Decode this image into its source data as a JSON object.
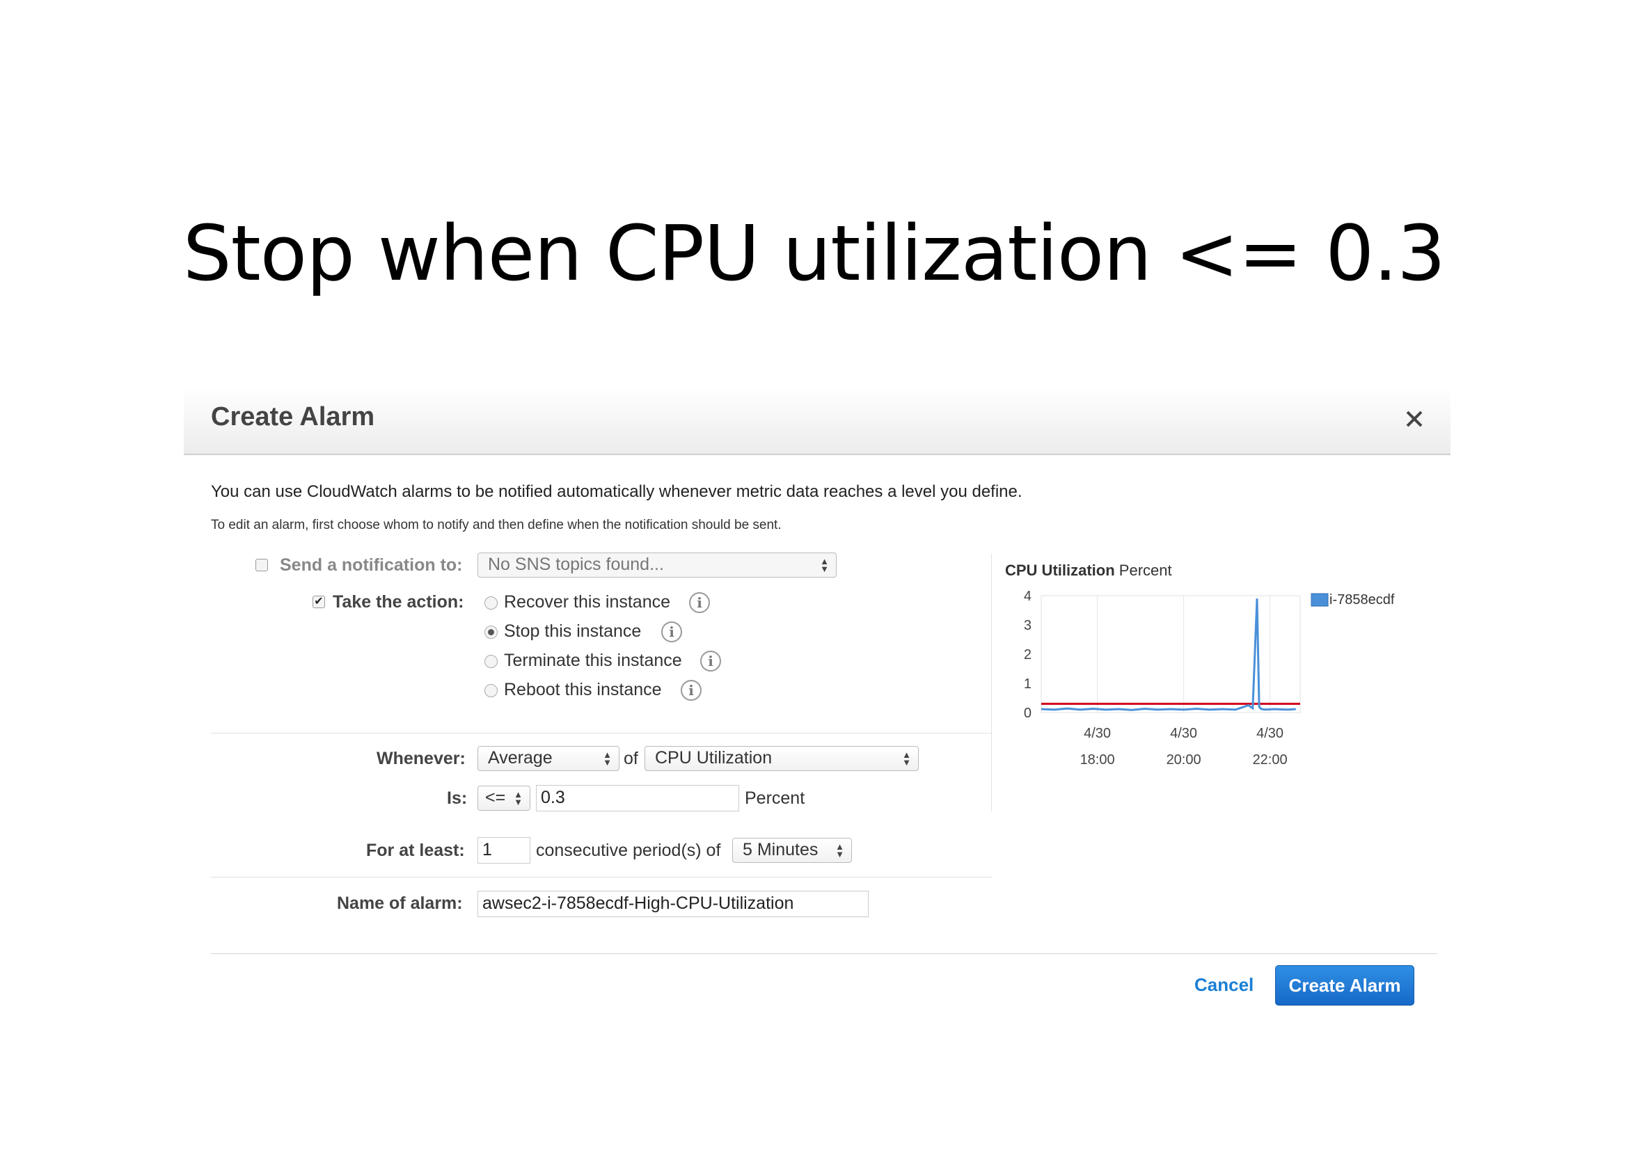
{
  "slide": {
    "title": "Stop when CPU utilization <= 0.3"
  },
  "dialog": {
    "title": "Create Alarm",
    "intro": "You can use CloudWatch alarms to be notified automatically whenever metric data reaches a level you define.",
    "intro_small": "To edit an alarm, first choose whom to notify and then define when the notification should be sent.",
    "notification": {
      "label": "Send a notification to:",
      "checked": false,
      "select_value": "No SNS topics found..."
    },
    "action": {
      "label": "Take the action:",
      "checked": true,
      "options": [
        {
          "label": "Recover this instance",
          "selected": false
        },
        {
          "label": "Stop this instance",
          "selected": true
        },
        {
          "label": "Terminate this instance",
          "selected": false
        },
        {
          "label": "Reboot this instance",
          "selected": false
        }
      ]
    },
    "whenever": {
      "label": "Whenever:",
      "statistic": "Average",
      "of_text": "of",
      "metric": "CPU Utilization"
    },
    "is": {
      "label": "Is:",
      "operator": "<=",
      "value": "0.3",
      "unit": "Percent"
    },
    "for_at_least": {
      "label": "For at least:",
      "periods": "1",
      "text": "consecutive period(s) of",
      "period": "5 Minutes"
    },
    "name": {
      "label": "Name of alarm:",
      "value": "awsec2-i-7858ecdf-High-CPU-Utilization"
    },
    "buttons": {
      "cancel": "Cancel",
      "create": "Create Alarm"
    }
  },
  "chart_data": {
    "type": "line",
    "title": "CPU Utilization",
    "unit_label": "Percent",
    "ylim": [
      0,
      4
    ],
    "y_ticks": [
      "4",
      "3",
      "2",
      "1",
      "0"
    ],
    "x_ticks": [
      {
        "date": "4/30",
        "time": "18:00"
      },
      {
        "date": "4/30",
        "time": "20:00"
      },
      {
        "date": "4/30",
        "time": "22:00"
      }
    ],
    "threshold": 0.3,
    "threshold_color": "#d0021b",
    "series": [
      {
        "name": "i-7858ecdf",
        "color": "#4a90d9",
        "x_hours": [
          16.7,
          17.0,
          17.3,
          17.6,
          17.9,
          18.2,
          18.5,
          18.8,
          19.1,
          19.4,
          19.7,
          20.0,
          20.3,
          20.6,
          20.9,
          21.2,
          21.5,
          21.6,
          21.7,
          21.75,
          21.8,
          21.9,
          22.1,
          22.4,
          22.6
        ],
        "values": [
          0.12,
          0.1,
          0.14,
          0.1,
          0.13,
          0.1,
          0.12,
          0.09,
          0.13,
          0.1,
          0.12,
          0.1,
          0.13,
          0.1,
          0.12,
          0.1,
          0.25,
          0.15,
          3.9,
          0.2,
          0.12,
          0.1,
          0.12,
          0.1,
          0.12
        ]
      }
    ],
    "grid": true,
    "legend": "right"
  }
}
